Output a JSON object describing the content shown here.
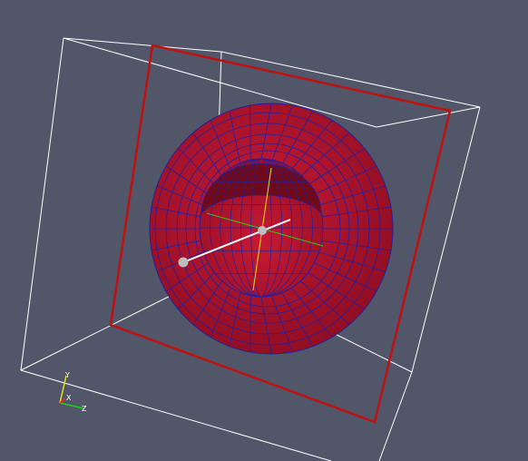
{
  "viewport": {
    "background": "#525669"
  },
  "colors": {
    "bounding_box": "#ffffff",
    "cut_plane_frame": "#c01010",
    "surface_fill": "#b0102a",
    "surface_fill_inner": "#c01530",
    "mesh_lines": "#2020a0",
    "widget_line": "#ffffff",
    "widget_handle": "#bdbdbd",
    "axis_x": "#ff2020",
    "axis_y": "#e0e020",
    "axis_z": "#20d020"
  },
  "orientation_axes": {
    "x_label": "X",
    "y_label": "Y",
    "z_label": "Z"
  },
  "icons": {
    "orientation": "orientation-axes-icon",
    "handle": "sphere-handle-icon"
  }
}
